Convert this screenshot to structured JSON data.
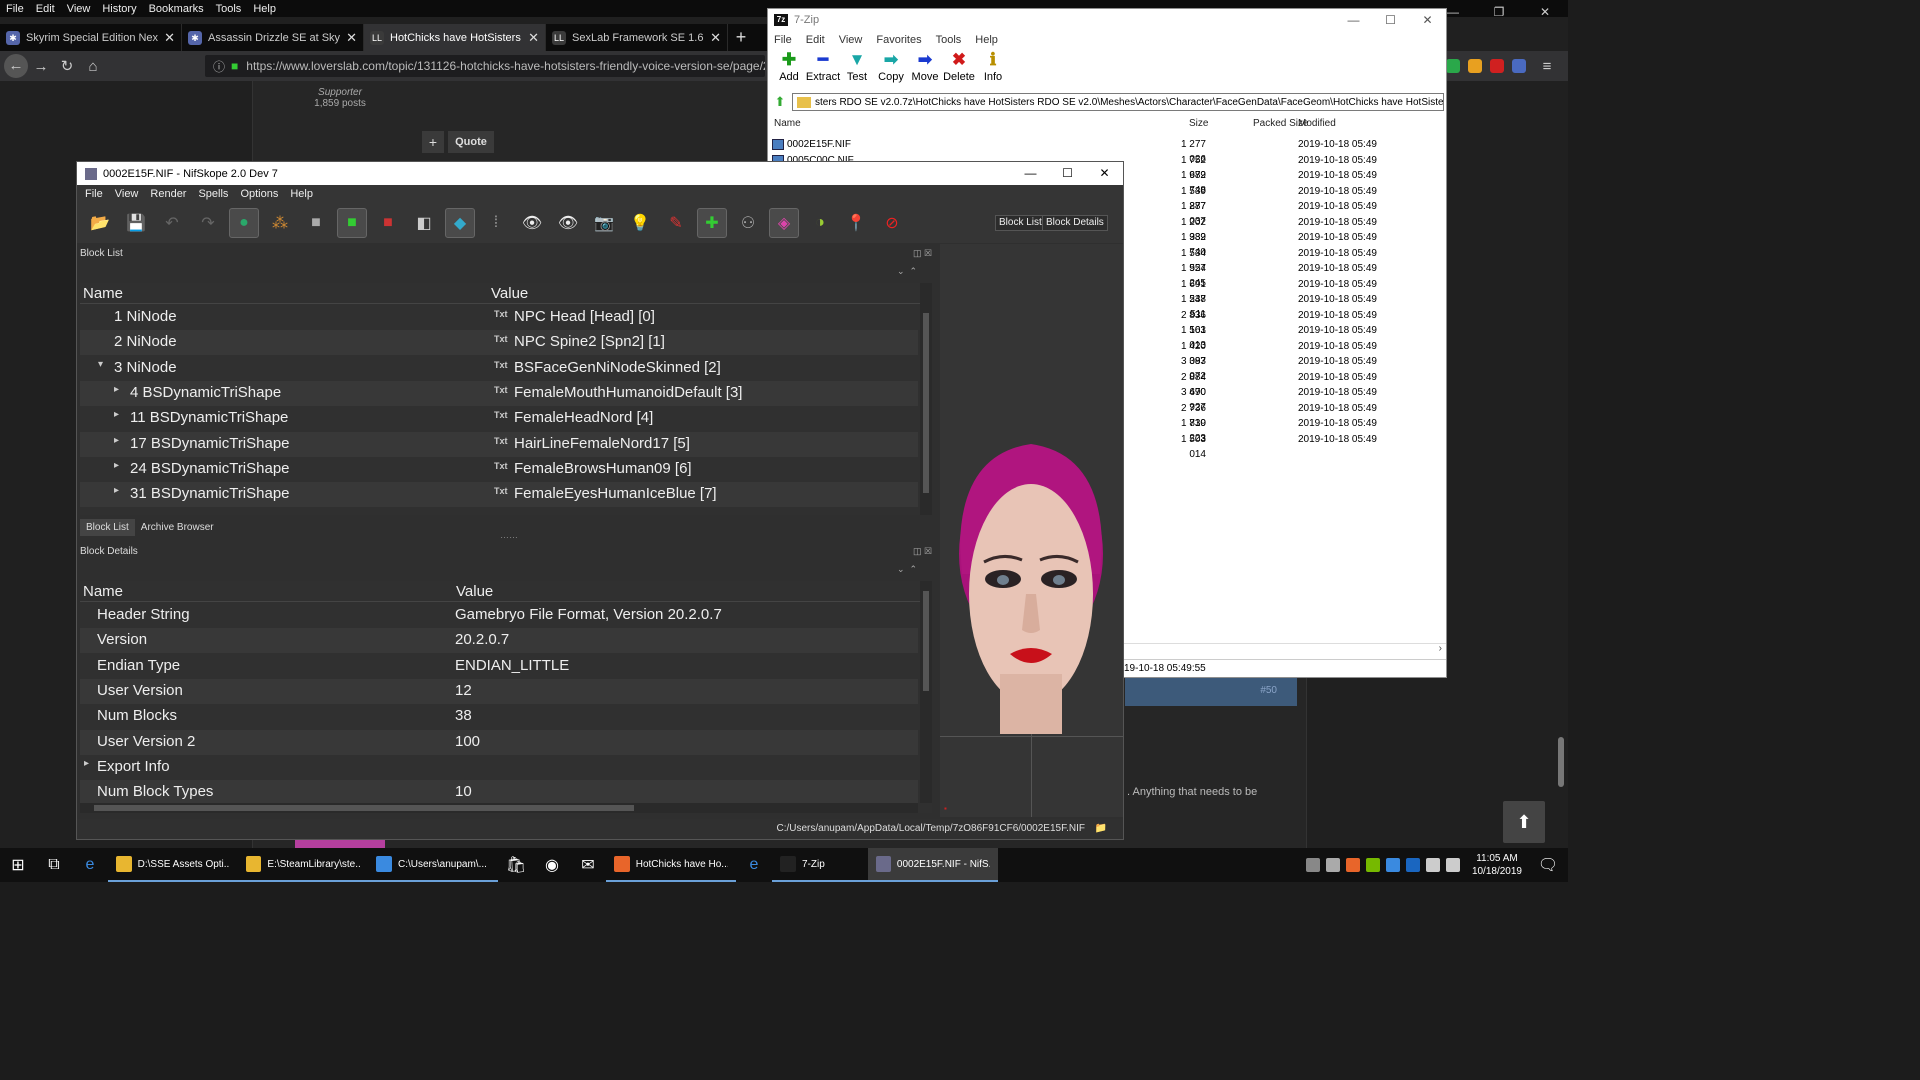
{
  "browser": {
    "menu": [
      "File",
      "Edit",
      "View",
      "History",
      "Bookmarks",
      "Tools",
      "Help"
    ],
    "tabs": [
      {
        "label": "Skyrim Special Edition Nexus -",
        "active": false
      },
      {
        "label": "Assassin Drizzle SE at Skyrim Sp",
        "active": false
      },
      {
        "label": "HotChicks have HotSisters - Fri",
        "active": true
      },
      {
        "label": "SexLab Framework SE 1.63 - BE",
        "active": false
      }
    ],
    "url": "https://www.loverslab.com/topic/131126-hotchicks-have-hotsisters-friendly-voice-version-se/page/2/",
    "page": {
      "supporter_role": "Supporter",
      "supporter_posts": "1,859 posts",
      "plus_label": "+",
      "quote_label": "Quote",
      "post_number": "#50",
      "post_text": ". Anything that needs to be",
      "scroll_top_icon": "arrow-up"
    }
  },
  "zip": {
    "title": "7-Zip",
    "menu": [
      "File",
      "Edit",
      "View",
      "Favorites",
      "Tools",
      "Help"
    ],
    "toolbar": [
      {
        "label": "Add",
        "glyph": "✚",
        "color": "#1a9a1a"
      },
      {
        "label": "Extract",
        "glyph": "━",
        "color": "#1a3ad0"
      },
      {
        "label": "Test",
        "glyph": "▼",
        "color": "#19a6a6"
      },
      {
        "label": "Copy",
        "glyph": "➡",
        "color": "#19a6a6"
      },
      {
        "label": "Move",
        "glyph": "➡",
        "color": "#1a3ad0"
      },
      {
        "label": "Delete",
        "glyph": "✖",
        "color": "#d01a1a"
      },
      {
        "label": "Info",
        "glyph": "ℹ",
        "color": "#b88f00"
      }
    ],
    "path": "sters RDO SE v2.0.7z\\HotChicks have HotSisters RDO SE v2.0\\Meshes\\Actors\\Character\\FaceGenData\\FaceGeom\\HotChicks have HotSisters.esp\\",
    "columns": {
      "name": "Name",
      "size": "Size",
      "packed": "Packed Size",
      "modified": "Modified"
    },
    "files": [
      {
        "name": "0002E15F.NIF",
        "size": "1 277 026",
        "modified": "2019-10-18 05:49"
      },
      {
        "name": "0005C00C.NIF",
        "size": "1 752 672",
        "modified": "2019-10-18 05:49"
      },
      {
        "name": "",
        "size": "1 989 748",
        "modified": "2019-10-18 05:49"
      },
      {
        "name": "",
        "size": "1 539 887",
        "modified": "2019-10-18 05:49"
      },
      {
        "name": "",
        "size": "1 277 037",
        "modified": "2019-10-18 05:49"
      },
      {
        "name": "",
        "size": "1 202 332",
        "modified": "2019-10-18 05:49"
      },
      {
        "name": "",
        "size": "1 989 740",
        "modified": "2019-10-18 05:49"
      },
      {
        "name": "",
        "size": "1 534 527",
        "modified": "2019-10-18 05:49"
      },
      {
        "name": "",
        "size": "1 954 245",
        "modified": "2019-10-18 05:49"
      },
      {
        "name": "",
        "size": "1 691 247",
        "modified": "2019-10-18 05:49"
      },
      {
        "name": "",
        "size": "1 538 511",
        "modified": "2019-10-18 05:49"
      },
      {
        "name": "",
        "size": "2 836 161",
        "modified": "2019-10-18 05:49"
      },
      {
        "name": "",
        "size": "1 503 013",
        "modified": "2019-10-18 05:49"
      },
      {
        "name": "",
        "size": "1 420 087",
        "modified": "2019-10-18 05:49"
      },
      {
        "name": "",
        "size": "3 393 072",
        "modified": "2019-10-18 05:49"
      },
      {
        "name": "",
        "size": "2 884 690",
        "modified": "2019-10-18 05:49"
      },
      {
        "name": "",
        "size": "3 470 927",
        "modified": "2019-10-18 05:49"
      },
      {
        "name": "",
        "size": "2 736 830",
        "modified": "2019-10-18 05:49"
      },
      {
        "name": "",
        "size": "1 719 223",
        "modified": "2019-10-18 05:49"
      },
      {
        "name": "",
        "size": "1 503 014",
        "modified": "2019-10-18 05:49"
      }
    ],
    "status": "19-10-18 05:49:55"
  },
  "nif": {
    "title": "0002E15F.NIF - NifSkope 2.0 Dev 7",
    "menu": [
      "File",
      "View",
      "Render",
      "Spells",
      "Options",
      "Help"
    ],
    "toolbar_buttons": [
      "Block List",
      "Block Details"
    ],
    "block_list": {
      "title": "Block List",
      "columns": {
        "name": "Name",
        "value": "Value"
      },
      "rows": [
        {
          "name": "1 NiNode",
          "value": "NPC Head [Head] [0]",
          "indent": 1,
          "arrow": ""
        },
        {
          "name": "2 NiNode",
          "value": "NPC Spine2 [Spn2] [1]",
          "indent": 1,
          "arrow": ""
        },
        {
          "name": "3 NiNode",
          "value": "BSFaceGenNiNodeSkinned [2]",
          "indent": 1,
          "arrow": "▾"
        },
        {
          "name": "4 BSDynamicTriShape",
          "value": "FemaleMouthHumanoidDefault [3]",
          "indent": 2,
          "arrow": "▸"
        },
        {
          "name": "11 BSDynamicTriShape",
          "value": "FemaleHeadNord [4]",
          "indent": 2,
          "arrow": "▸"
        },
        {
          "name": "17 BSDynamicTriShape",
          "value": "HairLineFemaleNord17 [5]",
          "indent": 2,
          "arrow": "▸"
        },
        {
          "name": "24 BSDynamicTriShape",
          "value": "FemaleBrowsHuman09 [6]",
          "indent": 2,
          "arrow": "▸"
        },
        {
          "name": "31 BSDynamicTriShape",
          "value": "FemaleEyesHumanIceBlue [7]",
          "indent": 2,
          "arrow": "▸"
        }
      ],
      "tag": "Txt"
    },
    "view_tabs": [
      "Block List",
      "Archive Browser"
    ],
    "block_details": {
      "title": "Block Details",
      "columns": {
        "name": "Name",
        "value": "Value"
      },
      "rows": [
        {
          "name": "Header String",
          "value": "Gamebryo File Format, Version 20.2.0.7",
          "arrow": ""
        },
        {
          "name": "Version",
          "value": "20.2.0.7",
          "arrow": ""
        },
        {
          "name": "Endian Type",
          "value": "ENDIAN_LITTLE",
          "arrow": ""
        },
        {
          "name": "User Version",
          "value": "12",
          "arrow": ""
        },
        {
          "name": "Num Blocks",
          "value": "38",
          "arrow": ""
        },
        {
          "name": "User Version 2",
          "value": "100",
          "arrow": ""
        },
        {
          "name": "Export Info",
          "value": "",
          "arrow": "▸"
        },
        {
          "name": "Num Block Types",
          "value": "10",
          "arrow": ""
        }
      ]
    },
    "status_path": "C:/Users/anupam/AppData/Local/Temp/7zO86F91CF6/0002E15F.NIF"
  },
  "taskbar": {
    "apps": [
      {
        "label": "D:\\SSE Assets Opti...",
        "color": "#e8b630",
        "active": false
      },
      {
        "label": "E:\\SteamLibrary\\ste...",
        "color": "#e8b630",
        "active": false
      },
      {
        "label": "C:\\Users\\anupam\\...",
        "color": "#3a8ae0",
        "active": false
      },
      {
        "label": "HotChicks have Ho...",
        "color": "#e8652a",
        "active": false
      },
      {
        "label": "7-Zip",
        "color": "#222222",
        "active": false
      },
      {
        "label": "0002E15F.NIF - NifS...",
        "color": "#6a6a8a",
        "active": true
      }
    ],
    "time": "11:05 AM",
    "date": "10/18/2019"
  }
}
